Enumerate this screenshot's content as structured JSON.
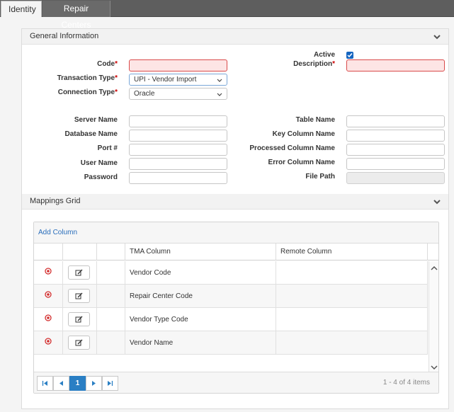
{
  "tabs": [
    {
      "label": "Identity",
      "active": true
    },
    {
      "label": "Repair Centers",
      "active": false
    }
  ],
  "general": {
    "title": "General Information",
    "code": {
      "label": "Code",
      "value": ""
    },
    "transaction_type": {
      "label": "Transaction Type",
      "value": "UPI - Vendor Import"
    },
    "connection_type": {
      "label": "Connection Type",
      "value": "Oracle"
    },
    "active": {
      "label": "Active",
      "checked": true
    },
    "description": {
      "label": "Description",
      "value": ""
    },
    "server_name": {
      "label": "Server Name",
      "value": ""
    },
    "database_name": {
      "label": "Database Name",
      "value": ""
    },
    "port": {
      "label": "Port #",
      "value": ""
    },
    "user_name": {
      "label": "User Name",
      "value": ""
    },
    "password": {
      "label": "Password",
      "value": ""
    },
    "table_name": {
      "label": "Table Name",
      "value": ""
    },
    "key_column_name": {
      "label": "Key Column Name",
      "value": ""
    },
    "processed_column_name": {
      "label": "Processed Column Name",
      "value": ""
    },
    "error_column_name": {
      "label": "Error Column Name",
      "value": ""
    },
    "file_path": {
      "label": "File Path",
      "value": ""
    }
  },
  "mappings": {
    "title": "Mappings Grid",
    "add_column_label": "Add Column",
    "columns": [
      "TMA Column",
      "Remote Column"
    ],
    "rows": [
      {
        "tma": "Vendor Code",
        "remote": ""
      },
      {
        "tma": "Repair Center Code",
        "remote": ""
      },
      {
        "tma": "Vendor Type Code",
        "remote": ""
      },
      {
        "tma": "Vendor Name",
        "remote": ""
      }
    ],
    "pager": {
      "current_page": "1",
      "info": "1 - 4 of 4 items"
    }
  },
  "colors": {
    "tab_bar": "#5e5e5e",
    "required_bg": "#fde5e5",
    "required_border": "#d94a4a",
    "accent": "#2a7fc4",
    "delete_icon": "#d32f2f",
    "checkbox": "#1565c0"
  },
  "icons": [
    "chevron-down-icon",
    "delete-icon",
    "edit-icon",
    "first-page-icon",
    "prev-page-icon",
    "next-page-icon",
    "last-page-icon",
    "scroll-up-icon",
    "scroll-down-icon",
    "checkmark-icon"
  ]
}
